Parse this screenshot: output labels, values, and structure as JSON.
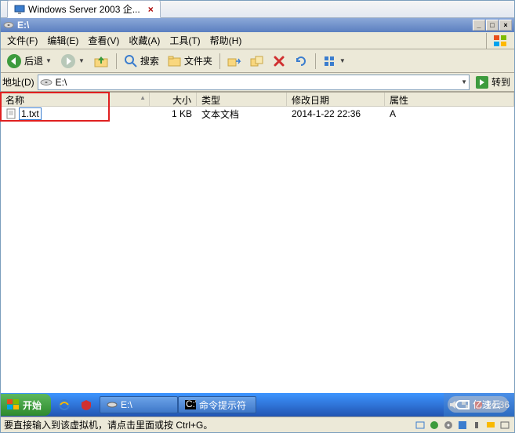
{
  "vm_tab": {
    "title": "Windows Server 2003 企...",
    "close": "×"
  },
  "inner_window": {
    "title": "E:\\",
    "buttons": {
      "min": "_",
      "max": "□",
      "close": "×"
    }
  },
  "menu": {
    "file": "文件(F)",
    "edit": "编辑(E)",
    "view": "查看(V)",
    "favorites": "收藏(A)",
    "tools": "工具(T)",
    "help": "帮助(H)"
  },
  "toolbar": {
    "back": "后退",
    "search": "搜索",
    "folders": "文件夹"
  },
  "addressbar": {
    "label": "地址(D)",
    "value": "E:\\",
    "go": "转到"
  },
  "columns": {
    "name": "名称",
    "size": "大小",
    "type": "类型",
    "modified": "修改日期",
    "attr": "属性"
  },
  "rows": [
    {
      "name": "1.txt",
      "size": "1 KB",
      "type": "文本文档",
      "modified": "2014-1-22 22:36",
      "attr": "A"
    }
  ],
  "taskbar": {
    "start": "开始",
    "task_explorer": "E:\\",
    "task_cmd": "命令提示符",
    "clock": "14:36"
  },
  "statusbar": {
    "text": "要直接输入到该虚拟机，请点击里面或按 Ctrl+G。"
  },
  "watermark": "亿速云"
}
